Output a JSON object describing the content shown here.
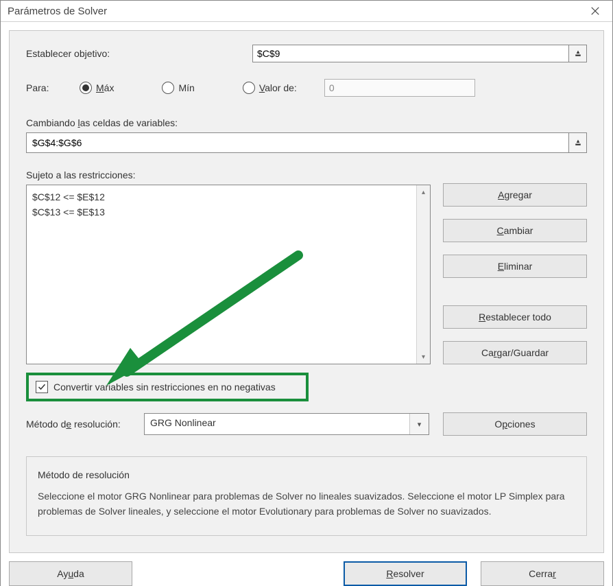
{
  "title": "Parámetros de Solver",
  "objective": {
    "label": "Establecer objetivo:",
    "value": "$C$9"
  },
  "para": {
    "label": "Para:",
    "options": {
      "max": "Máx",
      "min": "Mín",
      "valor": "Valor de:"
    },
    "selected": "max",
    "value_of": "0"
  },
  "variables": {
    "label": "Cambiando las celdas de variables:",
    "value": "$G$4:$G$6"
  },
  "constraints": {
    "label": "Sujeto a las restricciones:",
    "items": [
      "$C$12 <= $E$12",
      "$C$13 <= $E$13"
    ]
  },
  "side_buttons": {
    "add": "Agregar",
    "change": "Cambiar",
    "delete": "Eliminar",
    "reset_all": "Restablecer todo",
    "load_save": "Cargar/Guardar"
  },
  "nonneg": {
    "label": "Convertir variables sin restricciones en no negativas",
    "checked": true
  },
  "method": {
    "label": "Método de resolución:",
    "selected": "GRG Nonlinear",
    "options_btn": "Opciones"
  },
  "method_desc": {
    "heading": "Método de resolución",
    "body": "Seleccione el motor GRG Nonlinear para problemas de Solver no lineales suavizados. Seleccione el motor LP Simplex para problemas de Solver lineales, y seleccione el motor Evolutionary para problemas de Solver no suavizados."
  },
  "footer": {
    "help": "Ayuda",
    "solve": "Resolver",
    "close": "Cerrar"
  }
}
